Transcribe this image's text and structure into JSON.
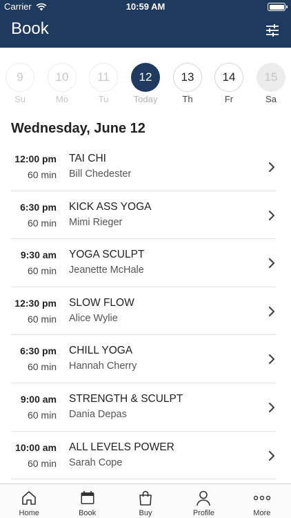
{
  "status_bar": {
    "carrier": "Carrier",
    "time": "10:59 AM"
  },
  "header": {
    "title": "Book",
    "filter_icon": "sliders-icon"
  },
  "date_strip": [
    {
      "number": "9",
      "label": "Su",
      "state": "past"
    },
    {
      "number": "10",
      "label": "Mo",
      "state": "past"
    },
    {
      "number": "11",
      "label": "Tu",
      "state": "past"
    },
    {
      "number": "12",
      "label": "Today",
      "state": "selected"
    },
    {
      "number": "13",
      "label": "Th",
      "state": "future"
    },
    {
      "number": "14",
      "label": "Fr",
      "state": "future"
    },
    {
      "number": "15",
      "label": "Sa",
      "state": "disabled"
    }
  ],
  "date_heading": "Wednesday, June 12",
  "classes": [
    {
      "time": "12:00 pm",
      "duration": "60 min",
      "name": "TAI CHI",
      "instructor": "Bill Chedester"
    },
    {
      "time": "6:30 pm",
      "duration": "60 min",
      "name": "KICK ASS YOGA",
      "instructor": "Mimi Rieger"
    },
    {
      "time": "9:30 am",
      "duration": "60 min",
      "name": "YOGA SCULPT",
      "instructor": "Jeanette McHale"
    },
    {
      "time": "12:30 pm",
      "duration": "60 min",
      "name": "SLOW FLOW",
      "instructor": "Alice Wylie"
    },
    {
      "time": "6:30 pm",
      "duration": "60 min",
      "name": "CHILL YOGA",
      "instructor": "Hannah Cherry"
    },
    {
      "time": "9:00 am",
      "duration": "60 min",
      "name": "STRENGTH & SCULPT",
      "instructor": "Dania Depas"
    },
    {
      "time": "10:00 am",
      "duration": "60 min",
      "name": "ALL LEVELS POWER",
      "instructor": "Sarah Cope"
    }
  ],
  "tabs": [
    {
      "label": "Home",
      "icon": "home-icon"
    },
    {
      "label": "Book",
      "icon": "calendar-icon"
    },
    {
      "label": "Buy",
      "icon": "shopping-bag-icon"
    },
    {
      "label": "Profile",
      "icon": "person-icon"
    },
    {
      "label": "More",
      "icon": "more-dots-icon"
    }
  ],
  "colors": {
    "brand": "#1f3a5f",
    "divider": "#e4e4e4"
  }
}
